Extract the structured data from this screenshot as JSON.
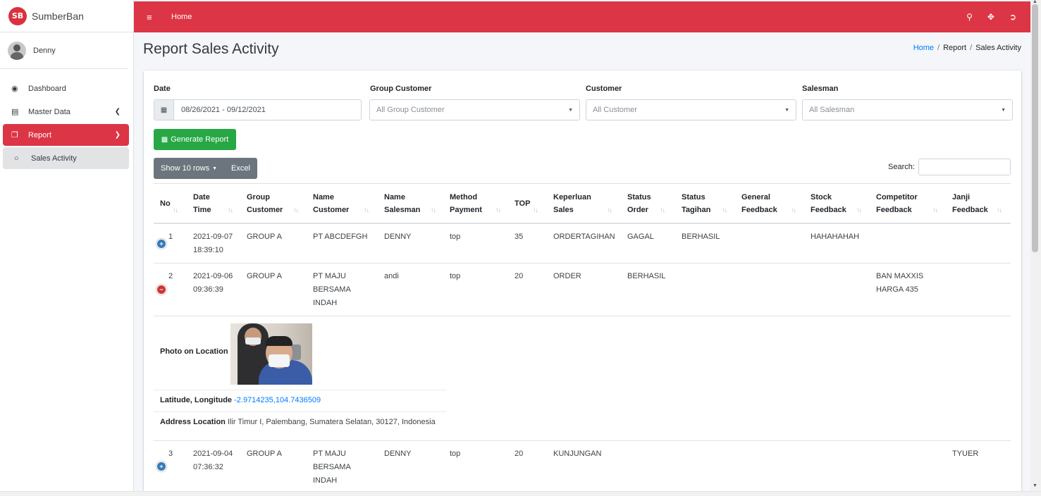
{
  "brand": {
    "logo": "SB",
    "name": "SumberBan"
  },
  "user": {
    "name": "Denny"
  },
  "sidebar": {
    "items": [
      {
        "label": "Dashboard",
        "icon": "dashboard-icon"
      },
      {
        "label": "Master Data",
        "icon": "book-icon"
      },
      {
        "label": "Report",
        "icon": "copy-icon"
      },
      {
        "label": "Sales Activity",
        "icon": "circle-icon"
      }
    ]
  },
  "topbar": {
    "home": "Home"
  },
  "page": {
    "title": "Report Sales Activity",
    "breadcrumb": [
      "Home",
      "Report",
      "Sales Activity"
    ]
  },
  "filters": {
    "date_label": "Date",
    "date_value": "08/26/2021 - 09/12/2021",
    "group_label": "Group Customer",
    "group_value": "All Group Customer",
    "customer_label": "Customer",
    "customer_value": "All Customer",
    "salesman_label": "Salesman",
    "salesman_value": "All Salesman"
  },
  "buttons": {
    "generate": "Generate Report",
    "show_rows": "Show 10 rows",
    "excel": "Excel"
  },
  "search": {
    "label": "Search:"
  },
  "table": {
    "headers": [
      [
        "No"
      ],
      [
        "Date",
        "Time"
      ],
      [
        "Group",
        "Customer"
      ],
      [
        "Name",
        "Customer"
      ],
      [
        "Name",
        "Salesman"
      ],
      [
        "Method",
        "Payment"
      ],
      [
        "TOP"
      ],
      [
        "Keperluan",
        "Sales"
      ],
      [
        "Status",
        "Order"
      ],
      [
        "Status",
        "Tagihan"
      ],
      [
        "General",
        "Feedback"
      ],
      [
        "Stock",
        "Feedback"
      ],
      [
        "Competitor",
        "Feedback"
      ],
      [
        "Janji",
        "Feedback"
      ]
    ],
    "rows": [
      {
        "no": "1",
        "date": "2021-09-07",
        "time": "18:39:10",
        "group": "GROUP A",
        "customer": [
          "PT ABCDEFGH"
        ],
        "salesman": "DENNY",
        "payment": "top",
        "top": "35",
        "keperluan": "ORDERTAGIHAN",
        "status_order": "GAGAL",
        "status_tagihan": "BERHASIL",
        "general": "",
        "stock": "HAHAHAHAH",
        "competitor": [
          "",
          ""
        ],
        "janji": ""
      },
      {
        "no": "2",
        "date": "2021-09-06",
        "time": "09:36:39",
        "group": "GROUP A",
        "customer": [
          "PT MAJU",
          "BERSAMA",
          "INDAH"
        ],
        "salesman": "andi",
        "payment": "top",
        "top": "20",
        "keperluan": "ORDER",
        "status_order": "BERHASIL",
        "status_tagihan": "",
        "general": "",
        "stock": "",
        "competitor": [
          "BAN MAXXIS",
          "HARGA 435"
        ],
        "janji": ""
      },
      {
        "no": "3",
        "date": "2021-09-04",
        "time": "07:36:32",
        "group": "GROUP A",
        "customer": [
          "PT MAJU",
          "BERSAMA",
          "INDAH"
        ],
        "salesman": "DENNY",
        "payment": "top",
        "top": "20",
        "keperluan": "KUNJUNGAN",
        "status_order": "",
        "status_tagihan": "",
        "general": "",
        "stock": "",
        "competitor": [
          "",
          ""
        ],
        "janji": "TYUER"
      }
    ],
    "detail": {
      "photo_label": "Photo on Location",
      "latlng_label": "Latitude, Longitude",
      "latlng_value": "-2.9714235,104.7436509",
      "address_label": "Address Location",
      "address_value": "Ilir Timur I, Palembang, Sumatera Selatan, 30127, Indonesia"
    }
  },
  "colors": {
    "primary": "#dc3545",
    "success": "#28a745",
    "secondary": "#6c757d",
    "link": "#007bff"
  }
}
